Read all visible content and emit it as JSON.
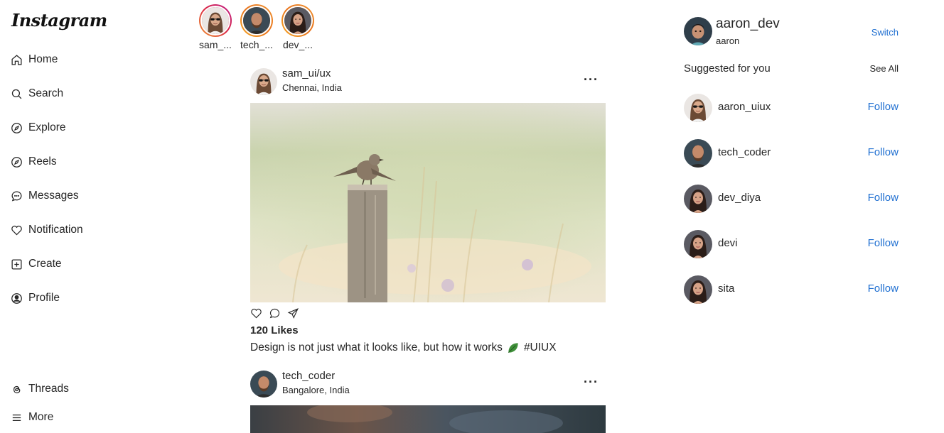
{
  "app": {
    "logo": "Instagram"
  },
  "sidebar": {
    "items": [
      {
        "label": "Home",
        "icon": "home-icon"
      },
      {
        "label": "Search",
        "icon": "search-icon"
      },
      {
        "label": "Explore",
        "icon": "compass-icon"
      },
      {
        "label": "Reels",
        "icon": "reels-icon"
      },
      {
        "label": "Messages",
        "icon": "message-icon"
      },
      {
        "label": "Notification",
        "icon": "heart-icon"
      },
      {
        "label": "Create",
        "icon": "plus-square-icon"
      },
      {
        "label": "Profile",
        "icon": "profile-icon"
      }
    ],
    "bottom": [
      {
        "label": "Threads",
        "icon": "threads-icon"
      },
      {
        "label": "More",
        "icon": "menu-icon"
      }
    ]
  },
  "stories": [
    {
      "label": "sam_...",
      "ring": "#e1306c"
    },
    {
      "label": "tech_...",
      "ring": "#f09433"
    },
    {
      "label": "dev_...",
      "ring": "#f09433"
    }
  ],
  "posts": [
    {
      "username": "sam_ui/ux",
      "location": "Chennai, India",
      "more": "···",
      "likes": "120 Likes",
      "caption": "Design is not just what it looks like, but how it works",
      "hashtag": "#UIUX"
    },
    {
      "username": "tech_coder",
      "location": "Bangalore, India",
      "more": "···"
    }
  ],
  "me": {
    "username": "aaron_dev",
    "name": "aaron",
    "switch": "Switch"
  },
  "suggestions": {
    "title": "Suggested for you",
    "see_all": "See All",
    "users": [
      {
        "name": "aaron_uiux",
        "action": "Follow"
      },
      {
        "name": "tech_coder",
        "action": "Follow"
      },
      {
        "name": "dev_diya",
        "action": "Follow"
      },
      {
        "name": "devi",
        "action": "Follow"
      },
      {
        "name": "sita",
        "action": "Follow"
      }
    ]
  },
  "colors": {
    "link": "#1f6fd1",
    "text": "#262626",
    "background": "#ffffff"
  }
}
